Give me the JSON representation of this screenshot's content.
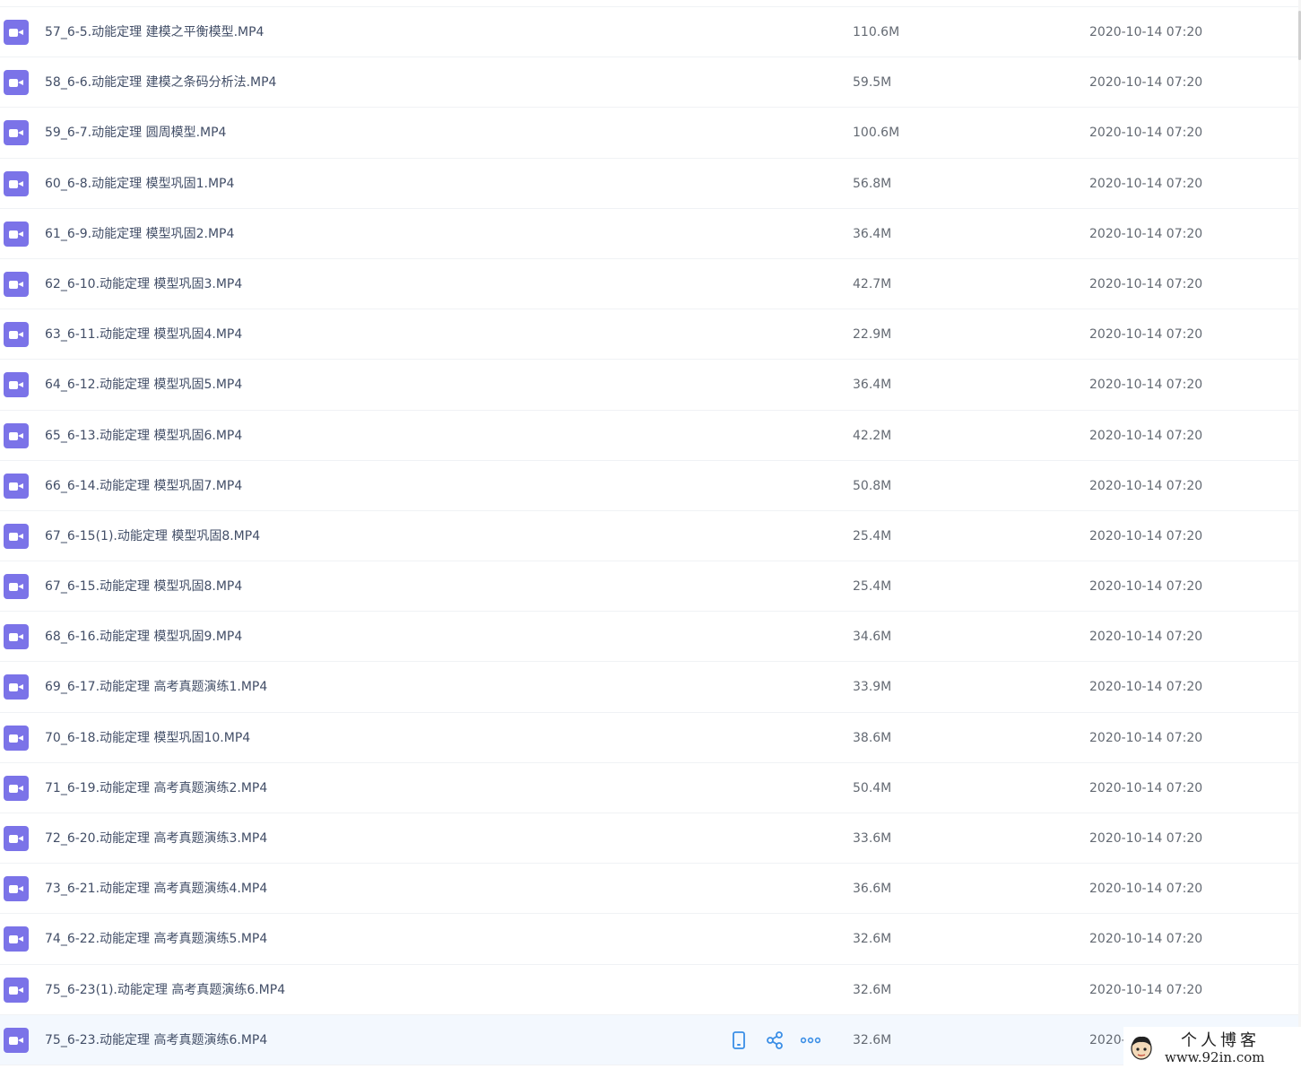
{
  "files": [
    {
      "name": "57_6-5.动能定理 建模之平衡模型.MP4",
      "size": "110.6M",
      "date": "2020-10-14 07:20",
      "icon": "video-file-icon"
    },
    {
      "name": "58_6-6.动能定理 建模之条码分析法.MP4",
      "size": "59.5M",
      "date": "2020-10-14 07:20",
      "icon": "video-file-icon"
    },
    {
      "name": "59_6-7.动能定理 圆周模型.MP4",
      "size": "100.6M",
      "date": "2020-10-14 07:20",
      "icon": "video-file-icon"
    },
    {
      "name": "60_6-8.动能定理 模型巩固1.MP4",
      "size": "56.8M",
      "date": "2020-10-14 07:20",
      "icon": "video-file-icon"
    },
    {
      "name": "61_6-9.动能定理 模型巩固2.MP4",
      "size": "36.4M",
      "date": "2020-10-14 07:20",
      "icon": "video-file-icon"
    },
    {
      "name": "62_6-10.动能定理 模型巩固3.MP4",
      "size": "42.7M",
      "date": "2020-10-14 07:20",
      "icon": "video-file-icon"
    },
    {
      "name": "63_6-11.动能定理 模型巩固4.MP4",
      "size": "22.9M",
      "date": "2020-10-14 07:20",
      "icon": "video-file-icon"
    },
    {
      "name": "64_6-12.动能定理 模型巩固5.MP4",
      "size": "36.4M",
      "date": "2020-10-14 07:20",
      "icon": "video-file-icon"
    },
    {
      "name": "65_6-13.动能定理 模型巩固6.MP4",
      "size": "42.2M",
      "date": "2020-10-14 07:20",
      "icon": "video-file-icon"
    },
    {
      "name": "66_6-14.动能定理 模型巩固7.MP4",
      "size": "50.8M",
      "date": "2020-10-14 07:20",
      "icon": "video-file-icon"
    },
    {
      "name": "67_6-15(1).动能定理 模型巩固8.MP4",
      "size": "25.4M",
      "date": "2020-10-14 07:20",
      "icon": "video-file-icon"
    },
    {
      "name": "67_6-15.动能定理 模型巩固8.MP4",
      "size": "25.4M",
      "date": "2020-10-14 07:20",
      "icon": "video-file-icon"
    },
    {
      "name": "68_6-16.动能定理 模型巩固9.MP4",
      "size": "34.6M",
      "date": "2020-10-14 07:20",
      "icon": "video-file-icon"
    },
    {
      "name": "69_6-17.动能定理 高考真题演练1.MP4",
      "size": "33.9M",
      "date": "2020-10-14 07:20",
      "icon": "video-file-icon"
    },
    {
      "name": "70_6-18.动能定理 模型巩固10.MP4",
      "size": "38.6M",
      "date": "2020-10-14 07:20",
      "icon": "video-file-icon"
    },
    {
      "name": "71_6-19.动能定理 高考真题演练2.MP4",
      "size": "50.4M",
      "date": "2020-10-14 07:20",
      "icon": "video-file-icon"
    },
    {
      "name": "72_6-20.动能定理 高考真题演练3.MP4",
      "size": "33.6M",
      "date": "2020-10-14 07:20",
      "icon": "video-file-icon"
    },
    {
      "name": "73_6-21.动能定理 高考真题演练4.MP4",
      "size": "36.6M",
      "date": "2020-10-14 07:20",
      "icon": "video-file-icon"
    },
    {
      "name": "74_6-22.动能定理 高考真题演练5.MP4",
      "size": "32.6M",
      "date": "2020-10-14 07:20",
      "icon": "video-file-icon"
    },
    {
      "name": "75_6-23(1).动能定理 高考真题演练6.MP4",
      "size": "32.6M",
      "date": "2020-10-14 07:20",
      "icon": "video-file-icon"
    },
    {
      "name": "75_6-23.动能定理 高考真题演练6.MP4",
      "size": "32.6M",
      "date": "2020-",
      "icon": "video-file-icon",
      "hovered": true,
      "actions": [
        "phone-icon",
        "share-icon",
        "more-icon"
      ]
    }
  ],
  "colors": {
    "video_icon": "#7b73e8",
    "hover_row": "#f3f8fe",
    "action_icon": "#3a8ee6",
    "divider": "#f0f2f5",
    "text_primary": "#424e67",
    "text_secondary": "#646a73"
  },
  "watermark": {
    "title": "个人博客",
    "url": "www.92in.com"
  }
}
